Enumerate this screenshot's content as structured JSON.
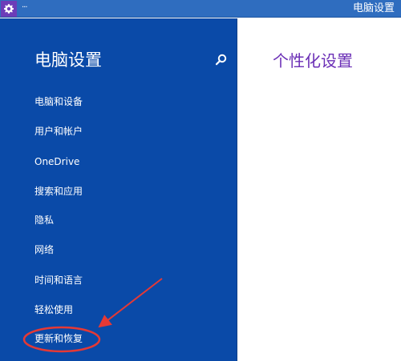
{
  "window": {
    "title": "电脑设置",
    "menu_dots": "···",
    "accent": "#6c3db8"
  },
  "icons": {
    "app": "gear-icon",
    "search": "search-icon"
  },
  "sidebar": {
    "title": "电脑设置",
    "items": [
      {
        "label": "电脑和设备"
      },
      {
        "label": "用户和帐户"
      },
      {
        "label": "OneDrive"
      },
      {
        "label": "搜索和应用"
      },
      {
        "label": "隐私"
      },
      {
        "label": "网络"
      },
      {
        "label": "时间和语言"
      },
      {
        "label": "轻松使用"
      },
      {
        "label": "更新和恢复"
      }
    ],
    "background": "#0a4aa8"
  },
  "main": {
    "title": "个性化设置",
    "title_color": "#6b2fb6"
  },
  "annotation": {
    "highlighted_item": "更新和恢复",
    "color": "#e53935"
  }
}
